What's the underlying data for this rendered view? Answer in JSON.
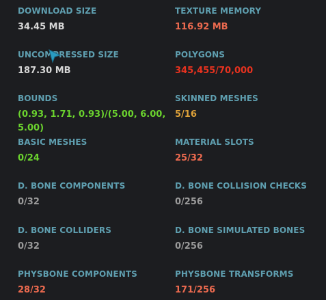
{
  "colors": {
    "background": "#1c1d20",
    "label": "#5f9fb0",
    "neutral": "#d6d6d6",
    "muted": "#9a9a9a",
    "good": "#6bd32e",
    "warn": "#e0a33a",
    "bad_soft": "#ec6a4f",
    "bad": "#e8321f"
  },
  "stats": [
    {
      "label": "DOWNLOAD SIZE",
      "value": "34.45 MB",
      "status": "neutral"
    },
    {
      "label": "TEXTURE MEMORY",
      "value": "116.92 MB",
      "status": "bad_soft"
    },
    {
      "label": "UNCOMPRESSED SIZE",
      "value": "187.30 MB",
      "status": "neutral"
    },
    {
      "label": "POLYGONS",
      "value": "345,455/70,000",
      "status": "bad"
    },
    {
      "label": "BOUNDS",
      "value": "(0.93, 1.71, 0.93)/(5.00, 6.00, 5.00)",
      "status": "good"
    },
    {
      "label": "SKINNED MESHES",
      "value": "5/16",
      "status": "warn"
    },
    {
      "label": "BASIC MESHES",
      "value": "0/24",
      "status": "good"
    },
    {
      "label": "MATERIAL SLOTS",
      "value": "25/32",
      "status": "bad_soft"
    },
    {
      "label": "D. BONE COMPONENTS",
      "value": "0/32",
      "status": "muted"
    },
    {
      "label": "D. BONE COLLISION CHECKS",
      "value": "0/256",
      "status": "muted"
    },
    {
      "label": "D. BONE COLLIDERS",
      "value": "0/32",
      "status": "muted"
    },
    {
      "label": "D. BONE SIMULATED BONES",
      "value": "0/256",
      "status": "muted"
    },
    {
      "label": "PHYSBONE COMPONENTS",
      "value": "28/32",
      "status": "bad_soft"
    },
    {
      "label": "PHYSBONE TRANSFORMS",
      "value": "171/256",
      "status": "bad_soft"
    }
  ],
  "cursor": {
    "icon": "mouse-pointer-icon",
    "color": "#2a9bc0"
  }
}
